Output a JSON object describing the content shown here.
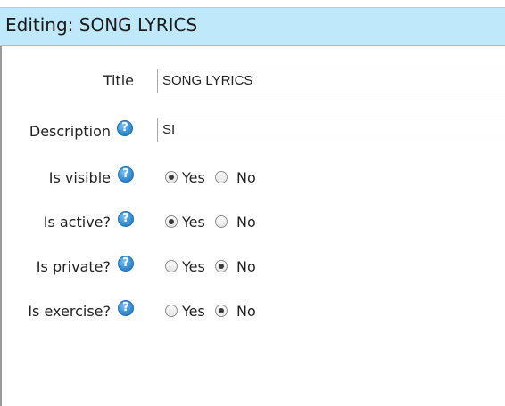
{
  "header": {
    "title": "Editing: SONG LYRICS"
  },
  "form": {
    "title": {
      "label": "Title",
      "value": "SONG LYRICS"
    },
    "description": {
      "label": "Description",
      "value": "SI"
    },
    "radios": [
      {
        "label": "Is visible",
        "yes_label": "Yes",
        "no_label": "No",
        "selected": "Yes"
      },
      {
        "label": "Is active?",
        "yes_label": "Yes",
        "no_label": "No",
        "selected": "Yes"
      },
      {
        "label": "Is private?",
        "yes_label": "Yes",
        "no_label": "No",
        "selected": "No"
      },
      {
        "label": "Is exercise?",
        "yes_label": "Yes",
        "no_label": "No",
        "selected": "No"
      }
    ]
  },
  "colors": {
    "header_bg": "#bfe8fb",
    "help_icon": "#3a8fd0"
  }
}
